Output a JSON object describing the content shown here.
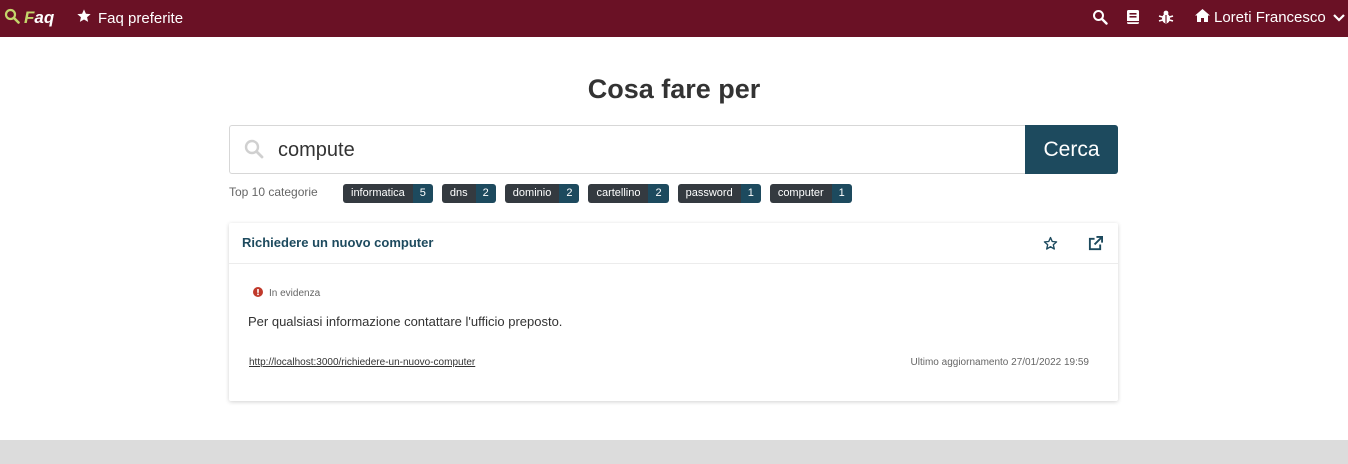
{
  "navbar": {
    "brand_letter": "F",
    "brand_rest": "aq",
    "favorites_label": "Faq preferite",
    "user_name": "Loreti Francesco",
    "icons": [
      "search-icon",
      "book-icon",
      "bug-icon",
      "home-icon",
      "chevron-down-icon"
    ]
  },
  "main": {
    "title": "Cosa fare per",
    "search": {
      "value": "compute",
      "button_label": "Cerca"
    },
    "categories_label": "Top 10 categorie",
    "categories": [
      {
        "name": "informatica",
        "count": "5"
      },
      {
        "name": "dns",
        "count": "2"
      },
      {
        "name": "dominio",
        "count": "2"
      },
      {
        "name": "cartellino",
        "count": "2"
      },
      {
        "name": "password",
        "count": "1"
      },
      {
        "name": "computer",
        "count": "1"
      }
    ]
  },
  "result": {
    "title": "Richiedere un nuovo computer",
    "badge": "In evidenza",
    "body": "Per qualsiasi informazione contattare l'ufficio preposto.",
    "link": "http://localhost:3000/richiedere-un-nuovo-computer",
    "updated": "Ultimo aggiornamento 27/01/2022 19:59"
  },
  "colors": {
    "navbar_bg": "#6a1125",
    "accent": "#1d4a5e",
    "brand_green": "#c4d66b",
    "alert_red": "#c0392b"
  }
}
